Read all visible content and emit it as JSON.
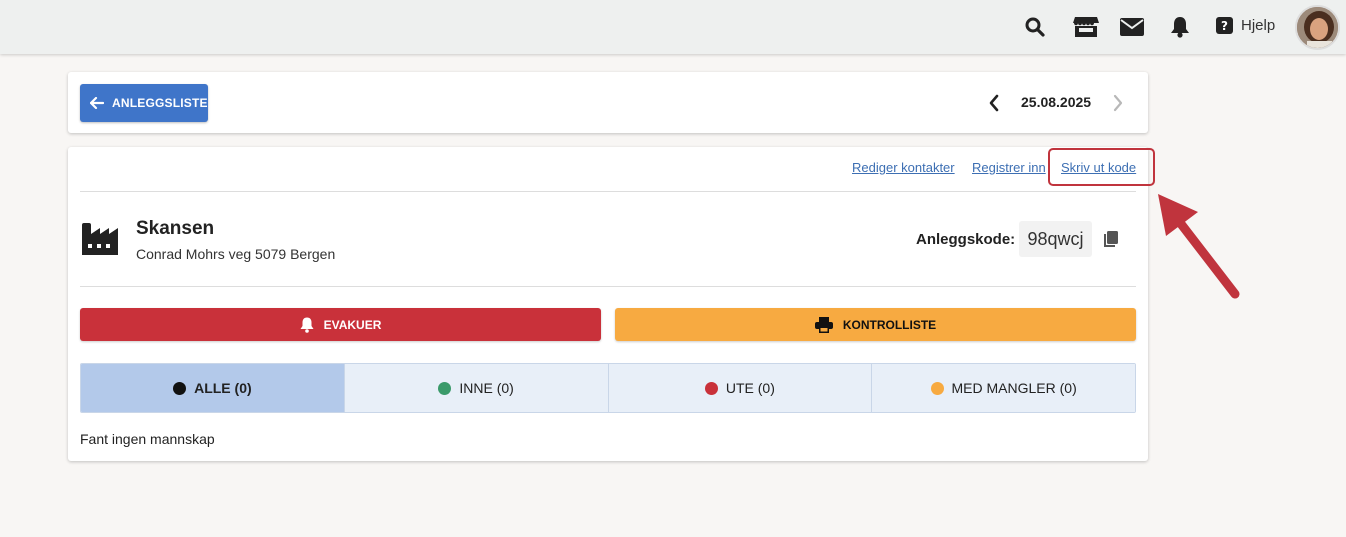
{
  "topbar": {
    "icons": [
      "search-icon",
      "store-icon",
      "mail-icon",
      "bell-icon"
    ],
    "help_label": "Hjelp"
  },
  "header": {
    "back_label": "ANLEGGSLISTE",
    "date": "25.08.2025"
  },
  "actions": {
    "edit_contacts": "Rediger kontakter",
    "register_in": "Registrer inn",
    "print_code": "Skriv ut kode"
  },
  "site": {
    "name": "Skansen",
    "address": "Conrad Mohrs veg 5079 Bergen",
    "code_label": "Anleggskode:",
    "code": "98qwcj"
  },
  "buttons": {
    "evacuate": "EVAKUER",
    "checklist": "KONTROLLISTE"
  },
  "tabs": [
    {
      "label": "ALLE (0)",
      "color": "#111111"
    },
    {
      "label": "INNE (0)",
      "color": "#3a9a6a"
    },
    {
      "label": "UTE (0)",
      "color": "#c9313a"
    },
    {
      "label": "MED MANGLER (0)",
      "color": "#f7aa41"
    }
  ],
  "empty_message": "Fant ingen mannskap",
  "colors": {
    "primary": "#3f75c9",
    "danger": "#c9313a",
    "warning": "#f7aa41",
    "highlight": "#c0343d"
  }
}
